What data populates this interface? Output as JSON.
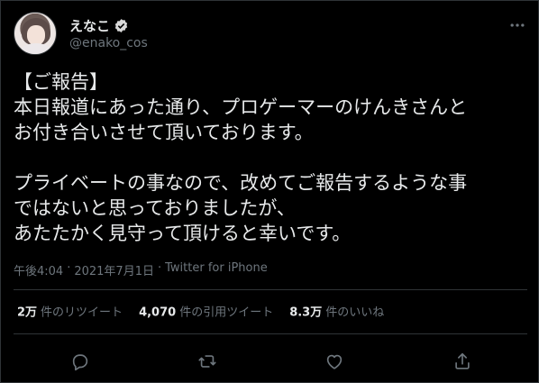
{
  "user": {
    "display_name": "えなこ",
    "handle": "@enako_cos",
    "verified": true,
    "avatar": "profile-photo"
  },
  "tweet": {
    "text": "【ご報告】\n本日報道にあった通り、プロゲーマーのけんきさんと\nお付き合いさせて頂いております。\n\nプライベートの事なので、改めてご報告するような事\nではないと思っておりましたが、\nあたたかく見守って頂けると幸いです。",
    "time": "午後4:04",
    "separator": "·",
    "date": "2021年7月1日",
    "source": "Twitter for iPhone"
  },
  "stats": {
    "retweets_num": "2万",
    "retweets_label": "件のリツイート",
    "quotes_num": "4,070",
    "quotes_label": "件の引用ツイート",
    "likes_num": "8.3万",
    "likes_label": "件のいいね"
  },
  "actions": [
    "reply-icon",
    "retweet-icon",
    "like-icon",
    "share-icon"
  ],
  "colors": {
    "background": "#000000",
    "text": "#e7e9ea",
    "muted": "#6e767d",
    "border": "#2f3336",
    "verified": "#d9d9d9"
  }
}
